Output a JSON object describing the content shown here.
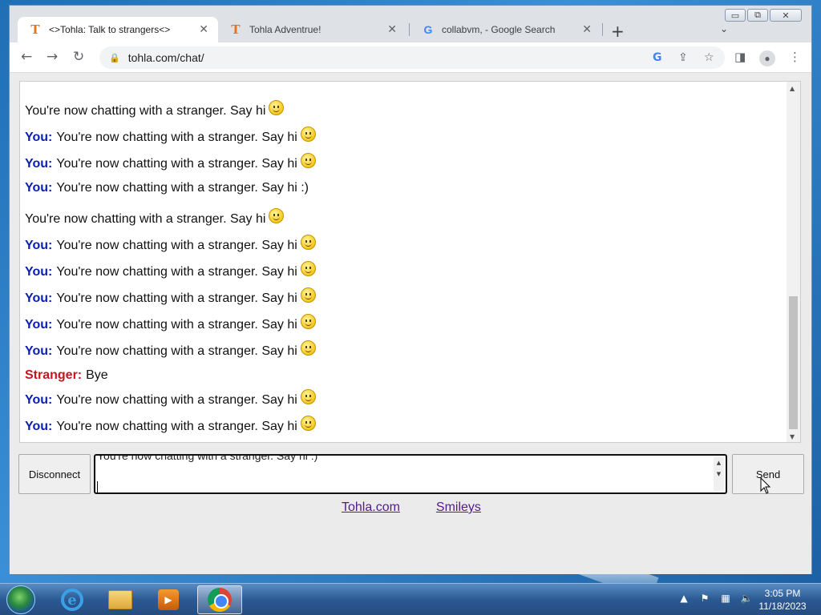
{
  "window": {
    "minimize_glyph": "▭",
    "maximize_glyph": "⧉",
    "close_glyph": "✕"
  },
  "tabs": [
    {
      "title": "<>Tohla: Talk to strangers<>",
      "favicon": "T",
      "active": true
    },
    {
      "title": "Tohla Adventrue!",
      "favicon": "T",
      "active": false
    },
    {
      "title": "collabvm, - Google Search",
      "favicon": "G",
      "active": false
    }
  ],
  "tab_close_glyph": "✕",
  "new_tab_glyph": "+",
  "tab_menu_glyph": "⌄",
  "toolbar": {
    "back_glyph": "←",
    "forward_glyph": "→",
    "reload_glyph": "↻",
    "lock_glyph": "🔒",
    "url": "tohla.com/chat/",
    "google_glyph": "G",
    "share_glyph": "⇪",
    "star_glyph": "☆",
    "sidepanel_glyph": "◨",
    "profile_glyph": "●",
    "menu_glyph": "⋮"
  },
  "chat": {
    "you_label": "You:",
    "stranger_label": "Stranger:",
    "messages": [
      {
        "who": "system",
        "text": "You're now chatting with a stranger. Say hi",
        "smiley": true
      },
      {
        "who": "you",
        "text": "You're now chatting with a stranger. Say hi",
        "smiley": true
      },
      {
        "who": "you",
        "text": "You're now chatting with a stranger. Say hi",
        "smiley": true
      },
      {
        "who": "you",
        "text": "You're now chatting with a stranger. Say hi :)",
        "smiley": false
      },
      {
        "who": "system",
        "text": "You're now chatting with a stranger. Say hi",
        "smiley": true
      },
      {
        "who": "you",
        "text": "You're now chatting with a stranger. Say hi",
        "smiley": true
      },
      {
        "who": "you",
        "text": "You're now chatting with a stranger. Say hi",
        "smiley": true
      },
      {
        "who": "you",
        "text": "You're now chatting with a stranger. Say hi",
        "smiley": true
      },
      {
        "who": "you",
        "text": "You're now chatting with a stranger. Say hi",
        "smiley": true
      },
      {
        "who": "you",
        "text": "You're now chatting with a stranger. Say hi",
        "smiley": true
      },
      {
        "who": "stranger",
        "text": "Bye",
        "smiley": false
      },
      {
        "who": "you",
        "text": "You're now chatting with a stranger. Say hi",
        "smiley": true
      },
      {
        "who": "you",
        "text": "You're now chatting with a stranger. Say hi",
        "smiley": true
      }
    ],
    "scroll_up_glyph": "▲",
    "scroll_down_glyph": "▼"
  },
  "controls": {
    "disconnect_label": "Disconnect",
    "input_value": "You're now chatting with a stranger. Say hi :)",
    "send_label": "Send"
  },
  "links": {
    "home": "Tohla.com",
    "smileys": "Smileys"
  },
  "taskbar": {
    "ie_glyph": "e",
    "media_glyph": "▶",
    "tray_arrow": "▲",
    "tray_flag": "⚑",
    "tray_network": "▦",
    "tray_volume": "🔈",
    "time": "3:05 PM",
    "date": "11/18/2023"
  }
}
